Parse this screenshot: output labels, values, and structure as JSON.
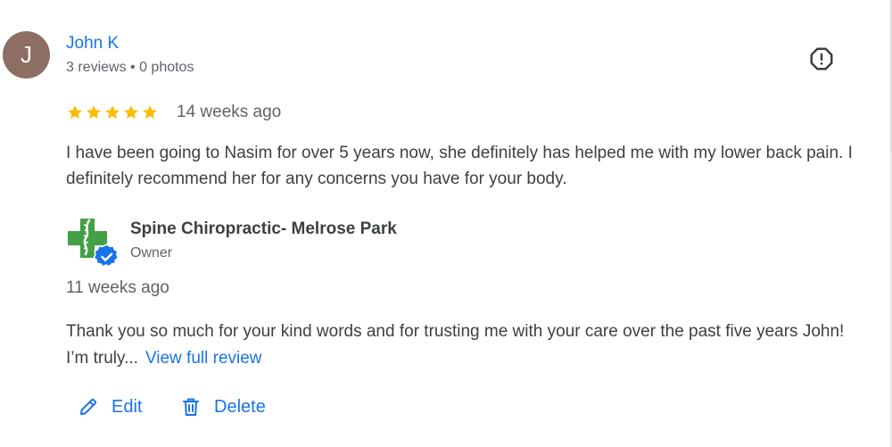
{
  "reviewer": {
    "avatar_initial": "J",
    "avatar_color": "#8d6e63",
    "name": "John K",
    "meta": "3 reviews • 0 photos"
  },
  "review": {
    "rating": 5,
    "max_rating": 5,
    "date": "14 weeks ago",
    "text": "I have been going to Nasim for over 5 years now, she definitely has helped me with my lower back pain. I definitely recommend her for any concerns you have for your body."
  },
  "owner_reply": {
    "business_name": "Spine Chiropractic- Melrose Park",
    "role": "Owner",
    "date": "11 weeks ago",
    "text": "Thank you so much for your kind words and for trusting me with your care over the past five years John! I’m truly...",
    "view_full_label": "View full review"
  },
  "actions": {
    "edit_label": "Edit",
    "delete_label": "Delete"
  },
  "icons": {
    "report": "report-flag-icon",
    "star": "star-icon",
    "verified": "verified-check-icon",
    "edit": "pencil-icon",
    "delete": "trash-icon"
  },
  "colors": {
    "link": "#1a73e8",
    "star": "#fbbc04",
    "logo_green": "#43a047",
    "verified_blue": "#1a73e8",
    "text": "#3c4043",
    "secondary_text": "#5f6368"
  }
}
